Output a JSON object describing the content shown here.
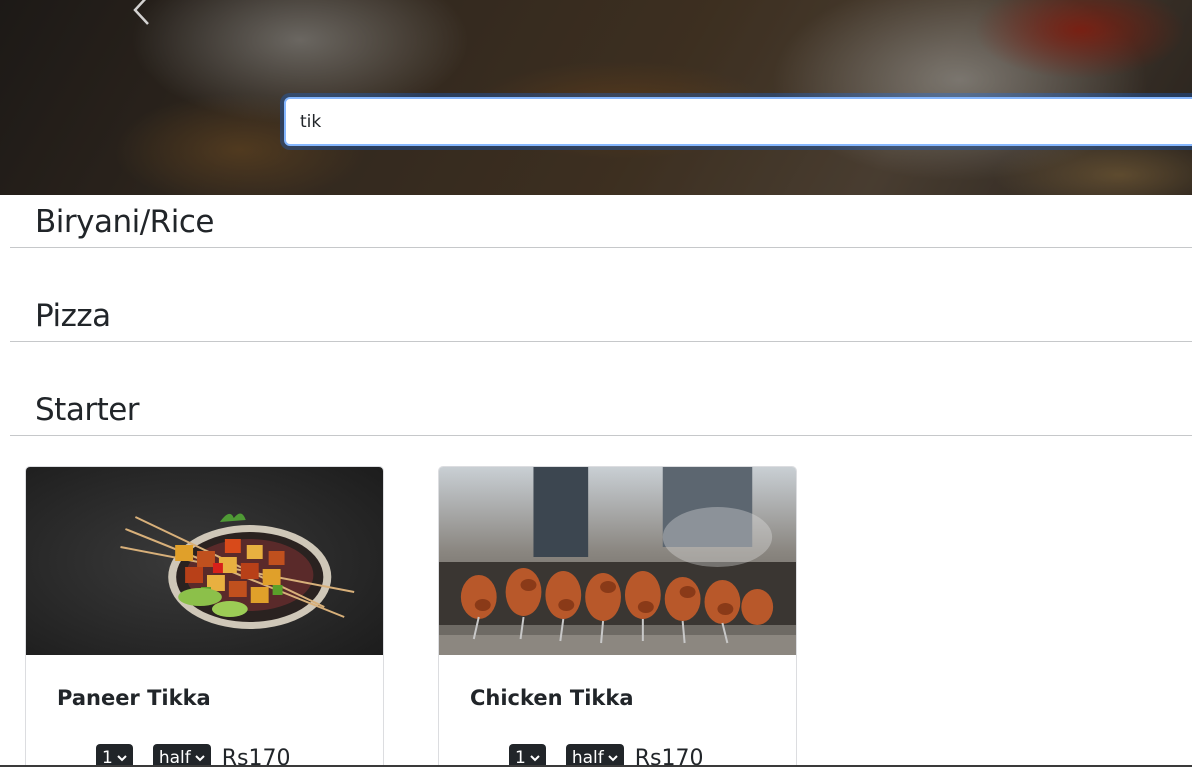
{
  "search": {
    "value": "tik"
  },
  "categories": [
    {
      "title": "Biryani/Rice"
    },
    {
      "title": "Pizza"
    },
    {
      "title": "Starter"
    }
  ],
  "items": [
    {
      "name": "Paneer Tikka",
      "qty": "1",
      "size": "half",
      "price": "Rs170"
    },
    {
      "name": "Chicken Tikka",
      "qty": "1",
      "size": "half",
      "price": "Rs170"
    }
  ],
  "icons": {
    "carousel_prev": "chevron-left-icon",
    "dropdown": "chevron-down-icon"
  },
  "colors": {
    "focus_border": "#86b7fe",
    "select_bg": "#212529",
    "divider": "#c6c8ca"
  }
}
